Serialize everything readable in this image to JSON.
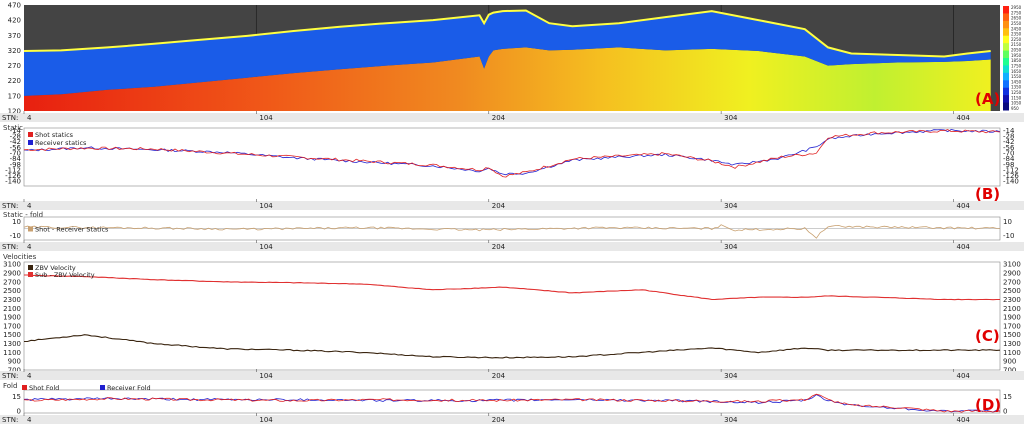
{
  "stn_axis": {
    "label": "STN:",
    "ticks": [
      "4",
      "104",
      "204",
      "304",
      "404"
    ],
    "range": [
      4,
      424
    ]
  },
  "panels": {
    "a": {
      "tag": "(A)",
      "yticks": [
        "470",
        "420",
        "370",
        "320",
        "270",
        "220",
        "170",
        "120"
      ],
      "ylim": [
        120,
        470
      ],
      "colorbar_ticks": [
        "2950",
        "2750",
        "2650",
        "2550",
        "2450",
        "2350",
        "2250",
        "2150",
        "2050",
        "1950",
        "1850",
        "1750",
        "1650",
        "1550",
        "1450",
        "1350",
        "1250",
        "1150",
        "1050",
        "950"
      ]
    },
    "b": {
      "title": "Static",
      "tag": "(B)",
      "yticks": [
        "-14",
        "-28",
        "-42",
        "-56",
        "-70",
        "-84",
        "-98",
        "-112",
        "-126",
        "-140"
      ],
      "ylim": [
        -152,
        -8
      ],
      "legend": [
        "Shot statics",
        "Receiver statics"
      ]
    },
    "f": {
      "title": "Static - fold",
      "yticks": [
        "10",
        "-10"
      ],
      "ylim": [
        -16,
        16
      ],
      "legend": [
        "Shot - Receiver Statics"
      ]
    },
    "c": {
      "title": "Velocities",
      "tag": "(C)",
      "yticks": [
        "3100",
        "2900",
        "2700",
        "2500",
        "2300",
        "2100",
        "1900",
        "1700",
        "1500",
        "1300",
        "1100",
        "900",
        "700"
      ],
      "ylim": [
        700,
        3150
      ],
      "legend": [
        "ZBV Velocity",
        "Sub - ZBV Velocity"
      ]
    },
    "d": {
      "title": "Fold",
      "tag": "(D)",
      "yticks": [
        "15",
        "0"
      ],
      "ylim": [
        -2,
        22
      ],
      "legend": [
        "Shot Fold",
        "Receiver Fold"
      ]
    }
  },
  "colors": {
    "shot": "#e02020",
    "receiver": "#2020d0",
    "sub_zbv": "#e03030",
    "zbv": "#3a2510",
    "fold_diff": "#c8a070",
    "surface": "#ffff40",
    "tag": "#e00000"
  },
  "chart_data": [
    {
      "type": "area",
      "name_ref": "panel-a",
      "x_label": "STN:",
      "x": [
        4,
        20,
        40,
        60,
        80,
        100,
        120,
        140,
        160,
        180,
        200,
        202,
        204,
        206,
        210,
        220,
        230,
        240,
        260,
        280,
        300,
        320,
        340,
        350,
        360,
        380,
        400,
        410,
        420
      ],
      "surface_elev": [
        318,
        320,
        330,
        342,
        355,
        368,
        384,
        398,
        410,
        420,
        436,
        410,
        438,
        445,
        450,
        452,
        410,
        400,
        410,
        430,
        450,
        420,
        390,
        330,
        310,
        305,
        300,
        310,
        318
      ],
      "weathering_base": [
        170,
        175,
        190,
        200,
        215,
        230,
        245,
        258,
        270,
        280,
        300,
        260,
        300,
        320,
        325,
        330,
        320,
        322,
        330,
        320,
        325,
        318,
        300,
        270,
        275,
        280,
        282,
        285,
        290
      ],
      "ylim": [
        120,
        470
      ]
    },
    {
      "type": "line",
      "name_ref": "panel-b",
      "x": [
        4,
        30,
        60,
        90,
        120,
        150,
        180,
        200,
        204,
        210,
        220,
        240,
        260,
        280,
        300,
        310,
        330,
        345,
        350,
        370,
        400,
        424
      ],
      "series": [
        {
          "name": "Shot statics",
          "values": [
            -62,
            -58,
            -60,
            -70,
            -80,
            -90,
            -100,
            -112,
            -105,
            -128,
            -118,
            -85,
            -78,
            -72,
            -90,
            -105,
            -80,
            -70,
            -30,
            -20,
            -15,
            -18
          ]
        },
        {
          "name": "Receiver statics",
          "values": [
            -64,
            -57,
            -62,
            -68,
            -82,
            -92,
            -102,
            -115,
            -108,
            -122,
            -120,
            -88,
            -80,
            -74,
            -88,
            -100,
            -82,
            -55,
            -35,
            -22,
            -14,
            -17
          ]
        }
      ],
      "ylim": [
        -152,
        -8
      ]
    },
    {
      "type": "line",
      "name_ref": "panel-fold-static",
      "x": [
        4,
        50,
        100,
        150,
        200,
        250,
        300,
        304,
        310,
        340,
        345,
        350,
        424
      ],
      "series": [
        {
          "name": "Shot - Receiver Statics",
          "values": [
            2,
            1,
            -1,
            1,
            -2,
            1,
            0,
            4,
            -2,
            0,
            -12,
            3,
            0
          ]
        }
      ],
      "ylim": [
        -16,
        16
      ]
    },
    {
      "type": "line",
      "name_ref": "panel-c",
      "x": [
        4,
        30,
        60,
        90,
        120,
        150,
        180,
        210,
        240,
        270,
        300,
        320,
        340,
        350,
        370,
        400,
        424
      ],
      "series": [
        {
          "name": "Sub - ZBV Velocity",
          "values": [
            2850,
            2820,
            2750,
            2700,
            2680,
            2650,
            2520,
            2580,
            2450,
            2520,
            2300,
            2350,
            2350,
            2380,
            2350,
            2300,
            2300
          ]
        },
        {
          "name": "ZBV Velocity",
          "values": [
            1350,
            1500,
            1300,
            1180,
            1150,
            1100,
            1000,
            980,
            1000,
            1100,
            1200,
            1100,
            1200,
            1150,
            1150,
            1150,
            1150
          ]
        }
      ],
      "ylim": [
        700,
        3150
      ]
    },
    {
      "type": "line",
      "name_ref": "panel-d",
      "x": [
        4,
        40,
        80,
        120,
        160,
        200,
        240,
        280,
        320,
        340,
        345,
        350,
        360,
        380,
        400,
        424
      ],
      "series": [
        {
          "name": "Shot Fold",
          "values": [
            11,
            13,
            12,
            11,
            12,
            11,
            12,
            11,
            10,
            12,
            18,
            12,
            6,
            4,
            0,
            0
          ]
        },
        {
          "name": "Receiver Fold",
          "values": [
            12,
            13,
            12,
            12,
            11,
            11,
            12,
            11,
            9,
            11,
            16,
            11,
            6,
            3,
            0,
            0
          ]
        }
      ],
      "ylim": [
        -2,
        22
      ]
    }
  ]
}
